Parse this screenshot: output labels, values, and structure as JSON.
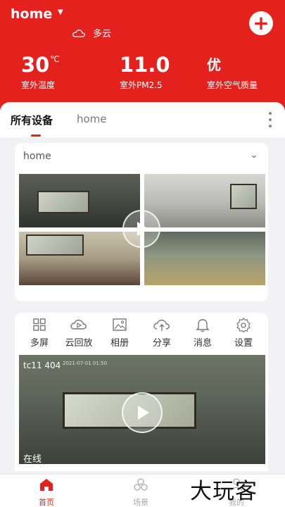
{
  "header": {
    "home_title": "home",
    "weather": {
      "icon": "cloud-icon",
      "text": "多云"
    },
    "add_button": {
      "icon": "plus-icon",
      "label": "+"
    },
    "stats": [
      {
        "value": "30",
        "unit": "℃",
        "label": "室外温度"
      },
      {
        "value": "11.0",
        "unit": "",
        "label": "室外PM2.5"
      },
      {
        "value": "优",
        "unit": "",
        "label": "室外空气质量"
      }
    ],
    "brand_color": "#e5211d"
  },
  "tabs": {
    "active": "所有设备",
    "home": "home",
    "more_icon": "more-vertical-icon"
  },
  "group_card": {
    "title": "home",
    "chevron_icon": "chevron-down-icon"
  },
  "actions": [
    {
      "icon": "grid-icon",
      "label": "多屏"
    },
    {
      "icon": "cloud-play-icon",
      "label": "云回放"
    },
    {
      "icon": "image-icon",
      "label": "相册"
    },
    {
      "icon": "cloud-upload-icon",
      "label": "分享"
    },
    {
      "icon": "bell-icon",
      "label": "消息"
    },
    {
      "icon": "gear-icon",
      "label": "设置"
    }
  ],
  "camera": {
    "name": "tc11 404",
    "timestamp": "2021-07-01 01:50",
    "status": "在线"
  },
  "bottom_nav": [
    {
      "icon": "home-icon",
      "label": "首页",
      "active": true
    },
    {
      "icon": "scene-icon",
      "label": "场景",
      "active": false
    },
    {
      "icon": "user-icon",
      "label": "我的",
      "active": false
    }
  ],
  "watermark": "大玩客"
}
